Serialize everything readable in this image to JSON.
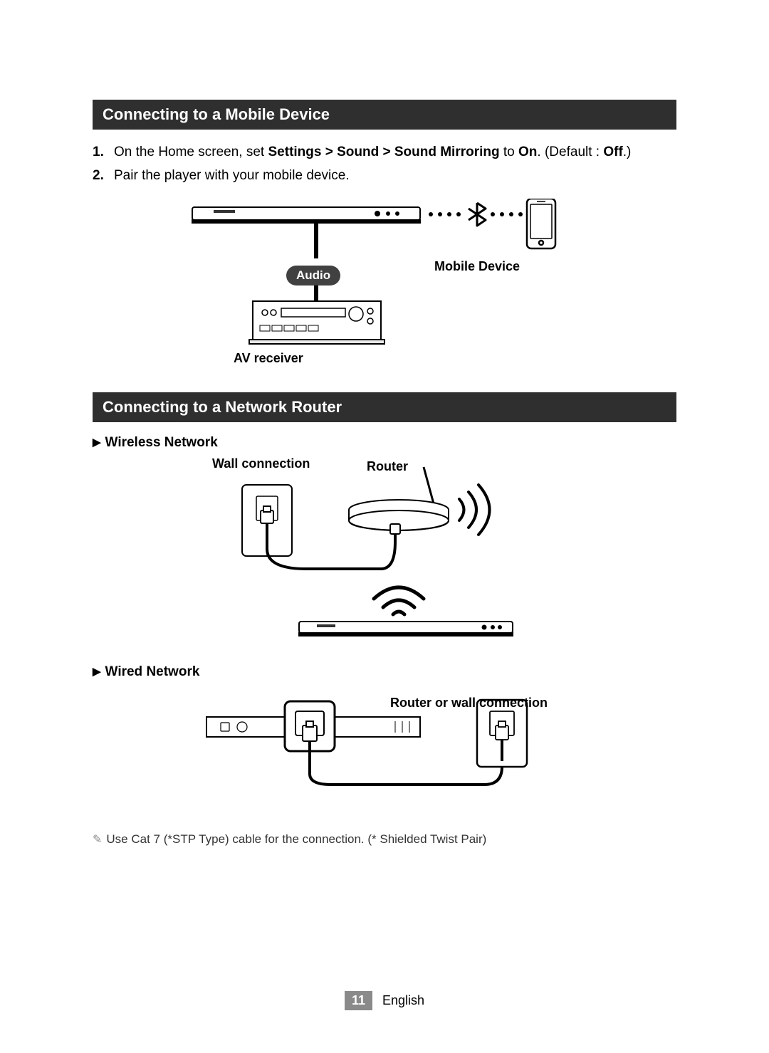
{
  "section1": {
    "title": "Connecting to a Mobile Device",
    "step1_num": "1.",
    "step1_a": "On the Home screen, set ",
    "step1_b": "Settings > Sound > Sound Mirroring",
    "step1_c": " to ",
    "step1_d": "On",
    "step1_e": ". (Default : ",
    "step1_f": "Off",
    "step1_g": ".)",
    "step2_num": "2.",
    "step2_text": "Pair the player with your mobile device.",
    "label_mobile": "Mobile Device",
    "label_audio": "Audio",
    "label_av": "AV receiver"
  },
  "section2": {
    "title": "Connecting to a Network Router",
    "sub_wireless": "Wireless Network",
    "label_wall": "Wall connection",
    "label_router": "Router",
    "sub_wired": "Wired Network",
    "label_router_wall": "Router or wall connection",
    "note": "Use Cat 7 (*STP Type) cable for the connection. (* Shielded Twist Pair)"
  },
  "footer": {
    "page": "11",
    "lang": "English"
  }
}
